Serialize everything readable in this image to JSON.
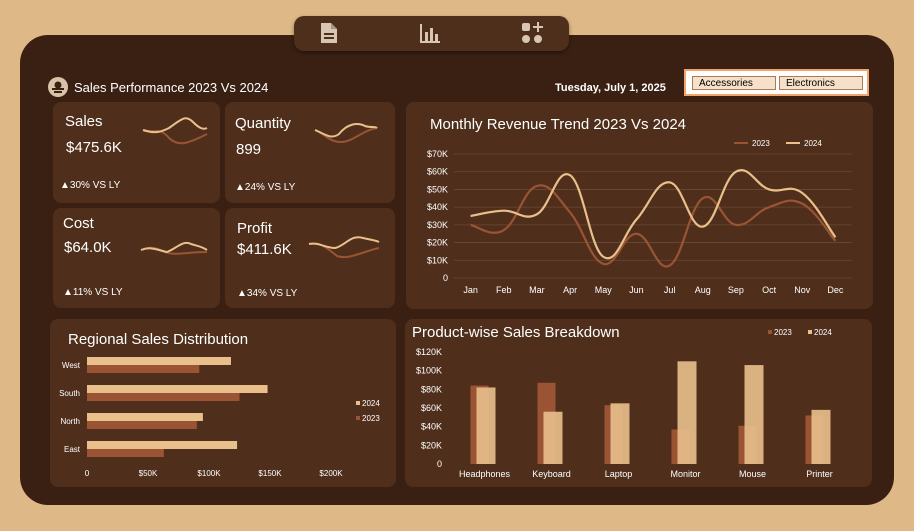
{
  "nav": {
    "icons": [
      "document-icon",
      "bar-chart-icon",
      "apps-plus-icon"
    ]
  },
  "header": {
    "title": "Sales Performance  2023 Vs 2024",
    "date": "Tuesday, July 1, 2025"
  },
  "slicer": {
    "items": [
      "Accessories",
      "Electronics"
    ]
  },
  "kpis": {
    "sales": {
      "name": "Sales",
      "value": "$475.6K",
      "delta": "▲30% VS LY"
    },
    "quantity": {
      "name": "Quantity",
      "value": "899",
      "delta": "▲24% VS LY"
    },
    "cost": {
      "name": "Cost",
      "value": "$64.0K",
      "delta": "▲11% VS LY"
    },
    "profit": {
      "name": "Profit",
      "value": "$411.6K",
      "delta": "▲34% VS LY"
    }
  },
  "colors": {
    "y2023": "#9a5434",
    "y2024": "#e9c08c",
    "panel": "#4f2f1b",
    "frame": "#3a2012",
    "page": "#deb887"
  },
  "chart_data": [
    {
      "type": "line",
      "title": "Monthly Revenue Trend 2023 Vs 2024",
      "x": [
        "Jan",
        "Feb",
        "Mar",
        "Apr",
        "May",
        "Jun",
        "Jul",
        "Aug",
        "Sep",
        "Oct",
        "Nov",
        "Dec"
      ],
      "series": [
        {
          "name": "2023",
          "values": [
            30000,
            27000,
            52000,
            37000,
            8000,
            25000,
            7000,
            45000,
            30000,
            40000,
            42000,
            21000
          ]
        },
        {
          "name": "2024",
          "values": [
            35000,
            38000,
            36000,
            58000,
            12000,
            33000,
            54000,
            29000,
            60000,
            50000,
            48000,
            23000
          ]
        }
      ],
      "yticks": [
        "0",
        "$10K",
        "$20K",
        "$30K",
        "$40K",
        "$50K",
        "$60K",
        "$70K"
      ],
      "ylim": [
        0,
        70000
      ],
      "legend": "top-right",
      "grid": true
    },
    {
      "type": "bar",
      "orientation": "horizontal",
      "title": "Regional Sales Distribution",
      "categories": [
        "West",
        "South",
        "North",
        "East"
      ],
      "series": [
        {
          "name": "2024",
          "values": [
            118000,
            148000,
            95000,
            123000
          ]
        },
        {
          "name": "2023",
          "values": [
            92000,
            125000,
            90000,
            63000
          ]
        }
      ],
      "xticks": [
        "0",
        "$50K",
        "$100K",
        "$150K",
        "$200K"
      ],
      "xlim": [
        0,
        200000
      ],
      "legend": "right"
    },
    {
      "type": "bar",
      "title": "Product-wise Sales Breakdown",
      "categories": [
        "Headphones",
        "Keyboard",
        "Laptop",
        "Monitor",
        "Mouse",
        "Printer"
      ],
      "series": [
        {
          "name": "2023",
          "values": [
            84000,
            87000,
            63000,
            37000,
            41000,
            52000
          ]
        },
        {
          "name": "2024",
          "values": [
            82000,
            56000,
            65000,
            110000,
            106000,
            58000
          ]
        }
      ],
      "yticks": [
        "0",
        "$20K",
        "$40K",
        "$60K",
        "$80K",
        "$100K",
        "$120K"
      ],
      "ylim": [
        0,
        120000
      ],
      "legend": "top-right"
    }
  ]
}
